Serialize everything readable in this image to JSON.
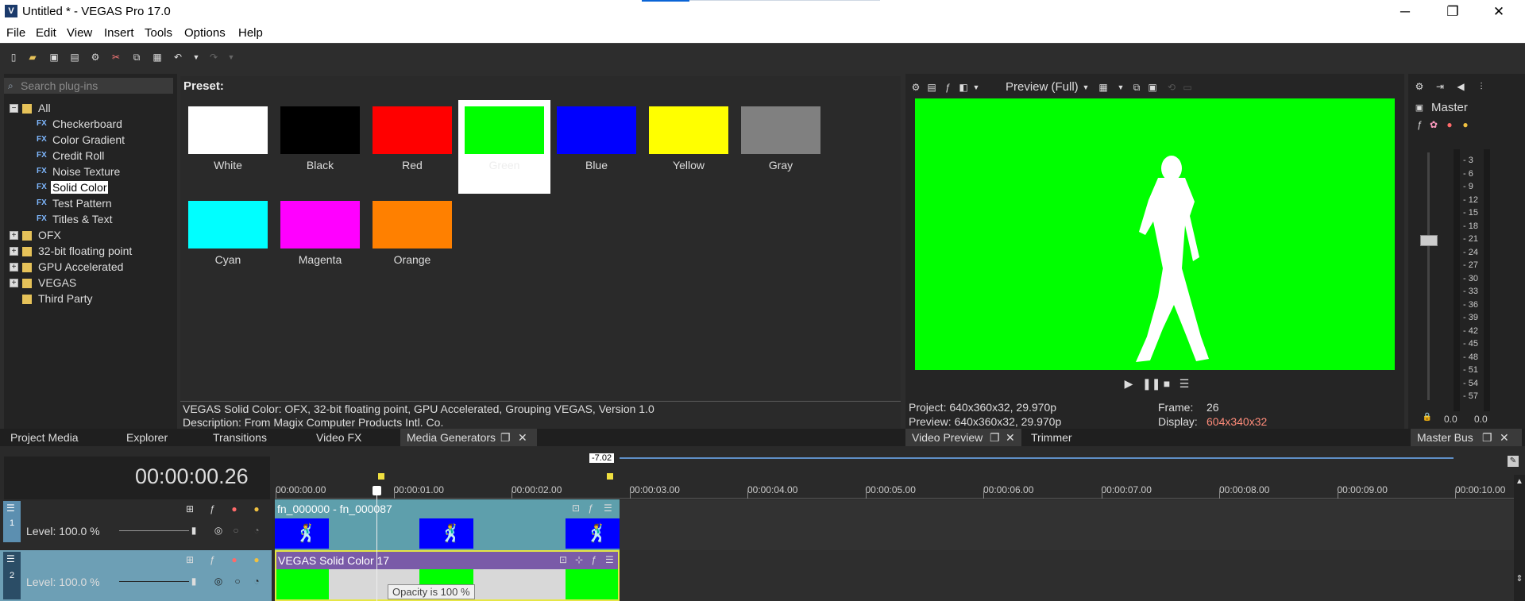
{
  "window": {
    "title": "Untitled * - VEGAS Pro 17.0",
    "icon_letter": "V",
    "minimize": "─",
    "restore": "❐",
    "close": "✕"
  },
  "menu": [
    "File",
    "Edit",
    "View",
    "Insert",
    "Tools",
    "Options",
    "Help"
  ],
  "toolbar_icons": [
    "new-icon",
    "open-icon",
    "save-icon",
    "save-as-icon",
    "properties-icon",
    "cut-icon",
    "copy-icon",
    "paste-icon",
    "undo-icon",
    "undo-dropdown-icon",
    "redo-icon",
    "redo-dropdown-icon"
  ],
  "plugins": {
    "search_placeholder": "Search plug-ins",
    "tree": [
      {
        "label": "All",
        "level": 0,
        "toggle": "−",
        "type": "folder"
      },
      {
        "label": "Checkerboard",
        "level": 1,
        "type": "fx"
      },
      {
        "label": "Color Gradient",
        "level": 1,
        "type": "fx"
      },
      {
        "label": "Credit Roll",
        "level": 1,
        "type": "fx"
      },
      {
        "label": "Noise Texture",
        "level": 1,
        "type": "fx"
      },
      {
        "label": "Solid Color",
        "level": 1,
        "type": "fx",
        "selected": true
      },
      {
        "label": "Test Pattern",
        "level": 1,
        "type": "fx"
      },
      {
        "label": "Titles & Text",
        "level": 1,
        "type": "fx"
      },
      {
        "label": "OFX",
        "level": 0,
        "toggle": "+",
        "type": "folder"
      },
      {
        "label": "32-bit floating point",
        "level": 0,
        "toggle": "+",
        "type": "folder"
      },
      {
        "label": "GPU Accelerated",
        "level": 0,
        "toggle": "+",
        "type": "folder"
      },
      {
        "label": "VEGAS",
        "level": 0,
        "toggle": "+",
        "type": "folder"
      },
      {
        "label": "Third Party",
        "level": 0,
        "type": "folder"
      }
    ]
  },
  "presets": {
    "label": "Preset:",
    "items": [
      {
        "label": "White",
        "color": "#ffffff"
      },
      {
        "label": "Black",
        "color": "#000000"
      },
      {
        "label": "Red",
        "color": "#ff0000"
      },
      {
        "label": "Green",
        "color": "#00ff00",
        "selected": true
      },
      {
        "label": "Blue",
        "color": "#0000ff"
      },
      {
        "label": "Yellow",
        "color": "#ffff00"
      },
      {
        "label": "Gray",
        "color": "#808080"
      },
      {
        "label": "Cyan",
        "color": "#00ffff"
      },
      {
        "label": "Magenta",
        "color": "#ff00ff"
      },
      {
        "label": "Orange",
        "color": "#ff8000"
      }
    ],
    "info_line1": "VEGAS Solid Color: OFX, 32-bit floating point, GPU Accelerated, Grouping VEGAS, Version 1.0",
    "info_line2": "Description: From Magix Computer Products Intl. Co."
  },
  "preview": {
    "mode": "Preview (Full)",
    "project": "Project:  640x360x32, 29.970p",
    "preview": "Preview: 640x360x32, 29.970p",
    "frame_label": "Frame:",
    "frame_value": "26",
    "display_label": "Display:",
    "display_value": "604x340x32",
    "display_color": "#ff8c7a"
  },
  "master": {
    "label": "Master",
    "ticks": [
      "3",
      "6",
      "9",
      "12",
      "15",
      "18",
      "21",
      "24",
      "27",
      "30",
      "33",
      "36",
      "39",
      "42",
      "45",
      "48",
      "51",
      "54",
      "57"
    ],
    "left_value": "0.0",
    "right_value": "0.0"
  },
  "tabs": {
    "left": [
      "Project Media",
      "Explorer",
      "Transitions",
      "Video FX",
      "Media Generators"
    ],
    "preview": [
      "Video Preview",
      "Trimmer"
    ],
    "master": "Master Bus"
  },
  "timeline": {
    "timecode": "00:00:00.26",
    "loop_marker": "-7.02",
    "ruler": [
      "00:00:00.00",
      "00:00:01.00",
      "00:00:02.00",
      "00:00:03.00",
      "00:00:04.00",
      "00:00:05.00",
      "00:00:06.00",
      "00:00:07.00",
      "00:00:08.00",
      "00:00:09.00",
      "00:00:10.00"
    ],
    "tracks": [
      {
        "number": "1",
        "level": "Level: 100.0 %",
        "event": "fn_000000 - fn_000087"
      },
      {
        "number": "2",
        "level": "Level: 100.0 %",
        "event": "VEGAS Solid Color 17"
      }
    ],
    "tooltip": "Opacity is 100 %"
  }
}
